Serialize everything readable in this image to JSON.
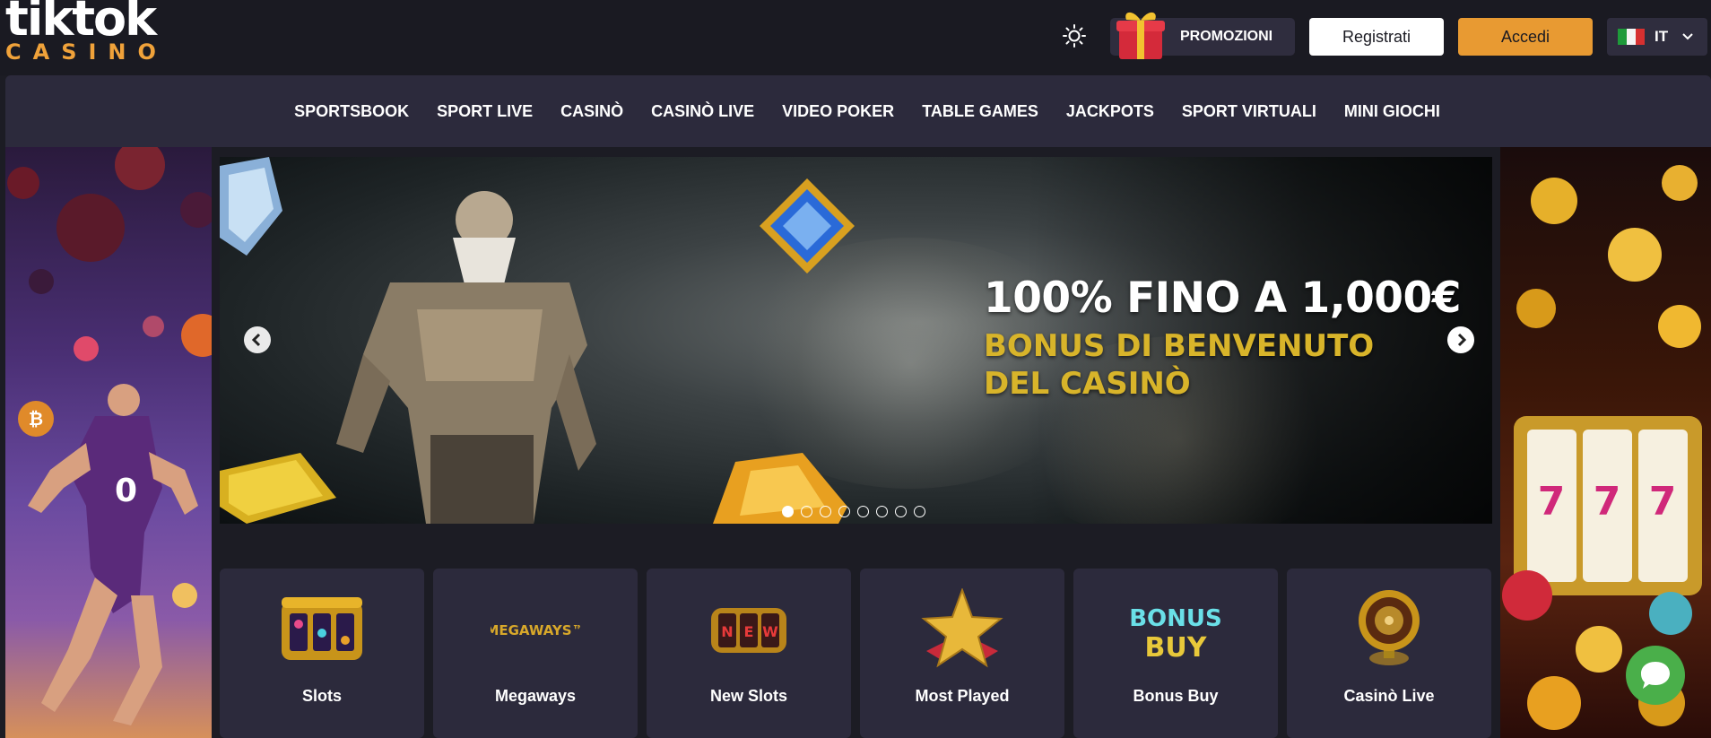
{
  "header": {
    "logo_top": "tiktok",
    "logo_bottom": "CASINO",
    "theme_toggle_icon": "sun-icon",
    "promo_label": "PROMOZIONI",
    "promo_icon": "gift-icon",
    "register_label": "Registrati",
    "login_label": "Accedi",
    "language_code": "IT",
    "language_icon": "italy-flag-icon",
    "colors": {
      "accent": "#e89a32",
      "background": "#1a1a22",
      "panel": "#2c2a3c"
    }
  },
  "nav": {
    "items": [
      {
        "label": "SPORTSBOOK"
      },
      {
        "label": "SPORT LIVE"
      },
      {
        "label": "CASINÒ"
      },
      {
        "label": "CASINÒ LIVE"
      },
      {
        "label": "VIDEO POKER"
      },
      {
        "label": "TABLE GAMES"
      },
      {
        "label": "JACKPOTS"
      },
      {
        "label": "SPORT VIRTUALI"
      },
      {
        "label": "MINI GIOCHI"
      }
    ]
  },
  "hero": {
    "title": "100% FINO A 1,000€",
    "subtitle": "BONUS DI BENVENUTO DEL CASINÒ",
    "slide_count": 8,
    "active_slide": 1,
    "subtitle_color": "#d8b42a"
  },
  "categories": [
    {
      "label": "Slots",
      "icon": "slot-machine-icon"
    },
    {
      "label": "Megaways",
      "icon": "megaways-logo"
    },
    {
      "label": "New Slots",
      "icon": "new-slots-icon"
    },
    {
      "label": "Most Played",
      "icon": "star-icon"
    },
    {
      "label": "Bonus Buy",
      "icon": "bonus-buy-logo"
    },
    {
      "label": "Casinò Live",
      "icon": "roulette-icon"
    }
  ],
  "megaways_logo_text": "MEGAWAYS™",
  "bonus_buy_logo_text": [
    "BONUS",
    "BUY"
  ],
  "new_slots_reel_letters": [
    "N",
    "E",
    "W"
  ],
  "chat": {
    "icon": "chat-bubble-icon",
    "color": "#4aaf4a"
  }
}
